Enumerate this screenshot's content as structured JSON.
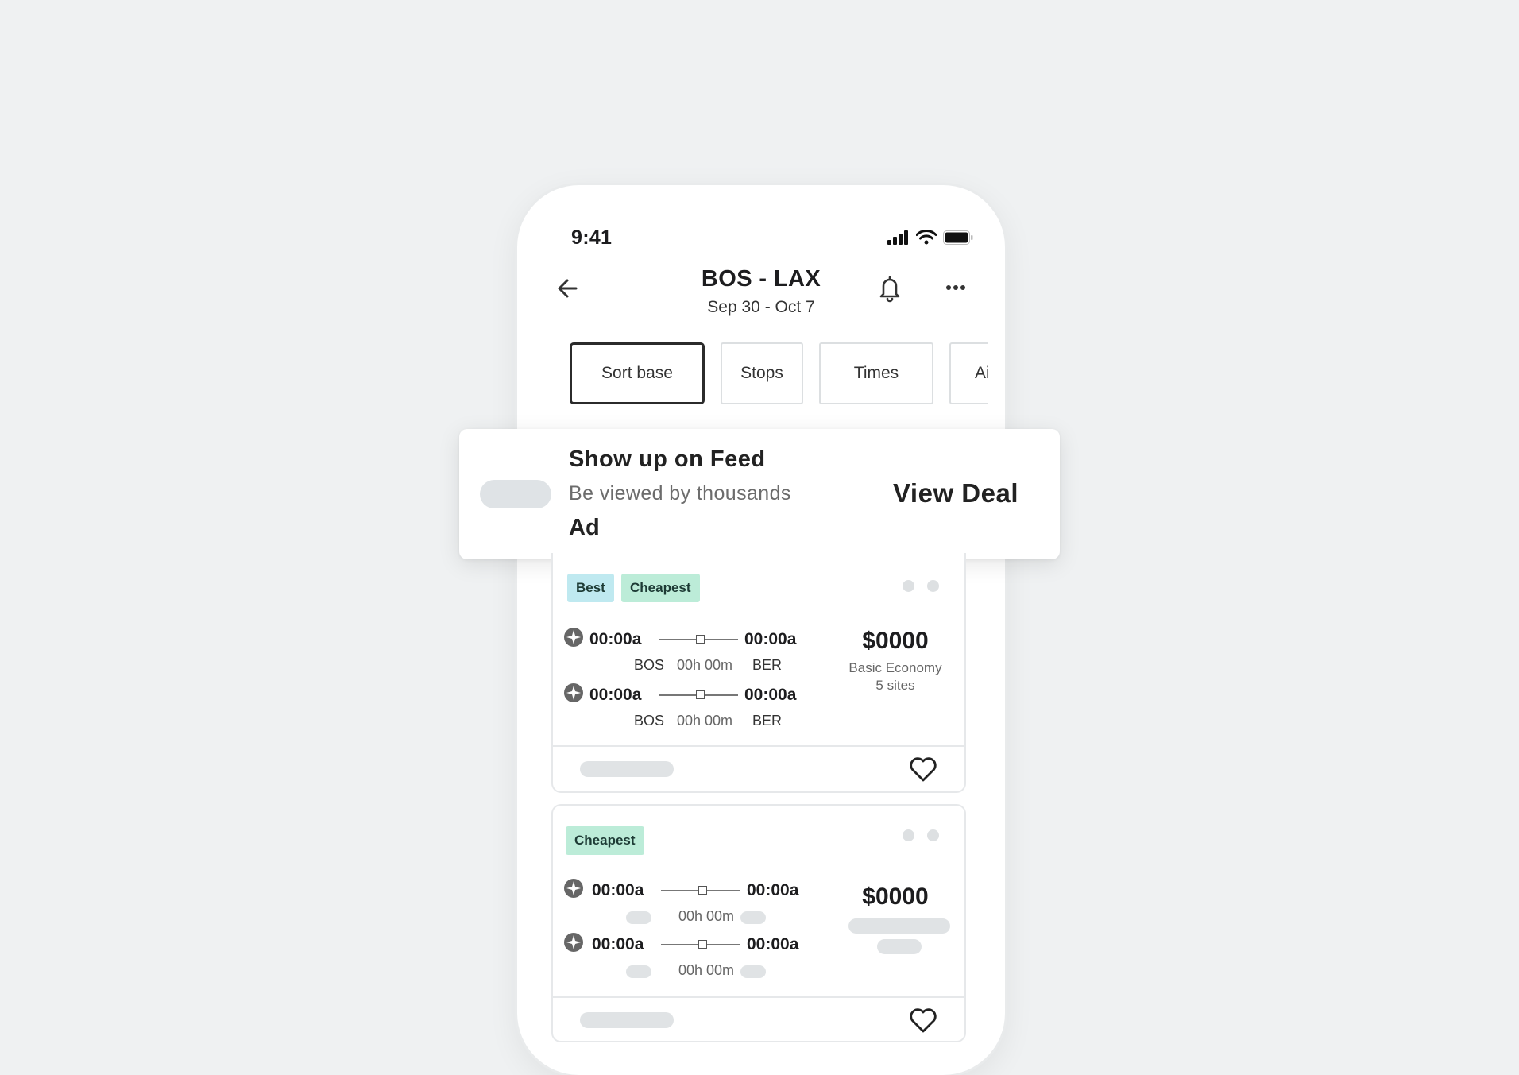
{
  "status_bar": {
    "time": "9:41"
  },
  "header": {
    "route": "BOS - LAX",
    "dates": "Sep 30 - Oct 7"
  },
  "filters": [
    "Sort base",
    "Stops",
    "Times",
    "Ai"
  ],
  "ad": {
    "title": "Show up on Feed",
    "subtitle": "Be viewed by thousands",
    "tag": "Ad",
    "cta": "View Deal"
  },
  "results": [
    {
      "badges": [
        "Best",
        "Cheapest"
      ],
      "legs": [
        {
          "depart": "00:00a",
          "arrive": "00:00a",
          "origin": "BOS",
          "duration": "00h 00m",
          "destination": "BER"
        },
        {
          "depart": "00:00a",
          "arrive": "00:00a",
          "origin": "BOS",
          "duration": "00h 00m",
          "destination": "BER"
        }
      ],
      "price": "$0000",
      "fare_class": "Basic Economy",
      "sites": "5 sites"
    },
    {
      "badges": [
        "Cheapest"
      ],
      "legs": [
        {
          "depart": "00:00a",
          "arrive": "00:00a",
          "duration": "00h 00m"
        },
        {
          "depart": "00:00a",
          "arrive": "00:00a",
          "duration": "00h 00m"
        }
      ],
      "price": "$0000"
    }
  ],
  "colors": {
    "badge_best": "#bfe9f0",
    "badge_cheapest": "#bcecd8",
    "background": "#eff1f2"
  }
}
